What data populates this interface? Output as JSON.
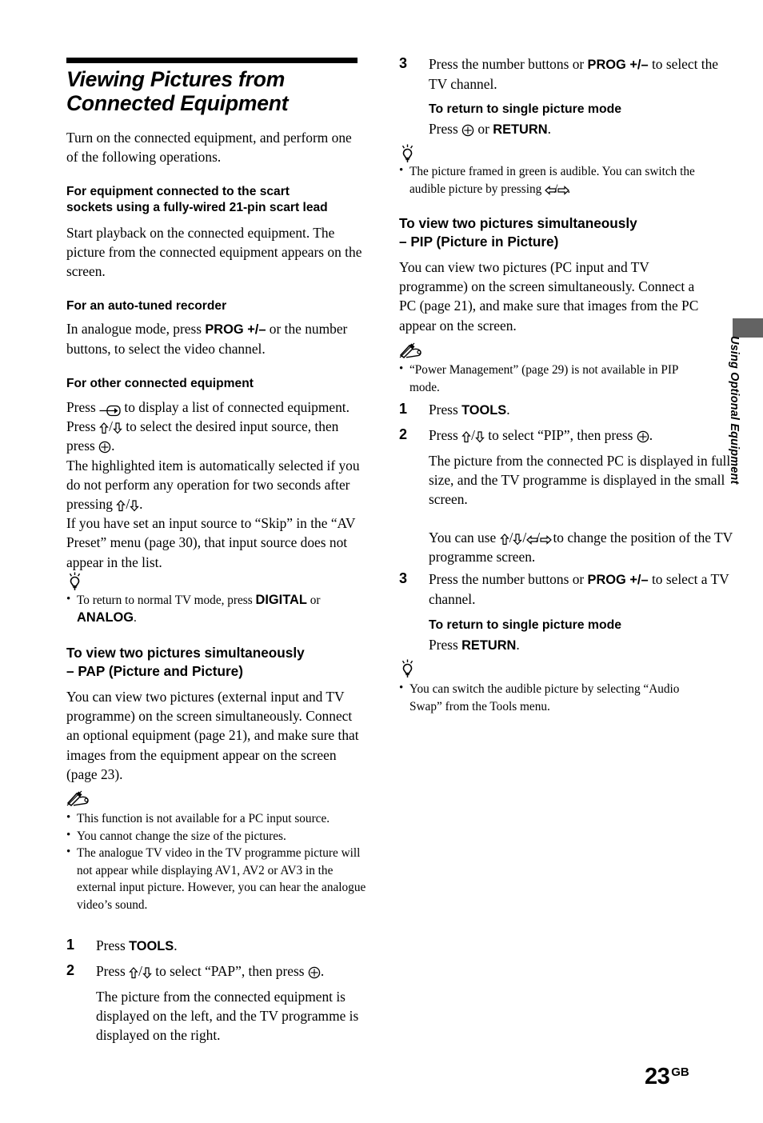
{
  "document": {
    "page_number": "23",
    "page_suffix": "GB",
    "side_tab_label": "Using Optional Equipment"
  },
  "section": {
    "title_line1": "Viewing Pictures from",
    "title_line2": "Connected Equipment",
    "intro": "Turn on the connected equipment, and perform one of the following operations."
  },
  "left_column": {
    "scart": {
      "heading_line1": "For equipment connected to the scart",
      "heading_line2": "sockets using a fully-wired 21-pin scart lead",
      "body": "Start playback on the connected equipment. The picture from the connected equipment appears on the screen."
    },
    "autotuned": {
      "heading": "For an auto-tuned recorder",
      "body_pre": "In analogue mode, press ",
      "body_bold": "PROG +/–",
      "body_post": " or the number buttons, to select the video channel."
    },
    "other_equipment": {
      "heading": "For other connected equipment",
      "p1_a": "Press ",
      "p1_b": " to display a list of connected equipment. Press ",
      "p1_c": " to select the desired input source, then press ",
      "p1_d": ".",
      "p2_a": "The highlighted item is automatically selected if you do not perform any operation for two seconds after pressing ",
      "p2_b": ".",
      "p3": "If you have set an input source to “Skip” in the “AV Preset” menu (page 30), that input source does not appear in the list."
    },
    "tip1": {
      "icon": "tip-bulb-icon",
      "item_a": "To return to normal TV mode, press ",
      "item_bold1": "DIGITAL",
      "item_b": " or ",
      "item_bold2": "ANALOG",
      "item_c": "."
    },
    "pap": {
      "heading_line1": "To view two pictures simultaneously",
      "heading_line2": "– PAP (Picture and Picture)",
      "body": "You can view two pictures (external input and TV programme) on the screen simultaneously. Connect an optional equipment (page 21), and make sure that images from the equipment appear on the screen (page 23).",
      "note_icon": "note-pencil-icon",
      "notes": [
        "This function is not available for a PC input source.",
        "You cannot change the size of the pictures.",
        "The analogue TV video in the TV programme picture will not appear while displaying AV1, AV2 or AV3 in the external input picture. However, you can hear the analogue video’s sound."
      ],
      "step1_num": "1",
      "step1_pre": "Press ",
      "step1_bold": "TOOLS",
      "step1_post": ".",
      "step2_num": "2",
      "step2_a": "Press ",
      "step2_b": " to select “PAP”, then press ",
      "step2_c": ".",
      "step2_body": "The picture from the connected equipment is displayed on the left, and the TV programme is displayed on the right."
    }
  },
  "right_column": {
    "pap_step3": {
      "num": "3",
      "text_pre": "Press the number buttons or ",
      "text_bold": "PROG +/–",
      "text_post": " to select the TV channel.",
      "return_heading": "To return to single picture mode",
      "return_pre": "Press ",
      "return_mid": " or ",
      "return_bold": "RETURN",
      "return_post": "."
    },
    "tip_pap": {
      "icon": "tip-bulb-icon",
      "item_a": "The picture framed in green is audible. You can switch the audible picture by pressing ",
      "item_b": "."
    },
    "pip": {
      "heading_line1": "To view two pictures simultaneously",
      "heading_line2": "– PIP (Picture in Picture)",
      "body": "You can view two pictures (PC input and TV programme) on the screen simultaneously. Connect a PC (page 21), and make sure that images from the PC appear on the screen.",
      "note_icon": "note-pencil-icon",
      "notes": [
        "“Power Management” (page 29) is not available in PIP mode."
      ],
      "step1_num": "1",
      "step1_pre": "Press ",
      "step1_bold": "TOOLS",
      "step1_post": ".",
      "step2_num": "2",
      "step2_a": "Press ",
      "step2_b": " to select “PIP”, then press ",
      "step2_c": ".",
      "step2_body_1": "The picture from the connected PC is displayed in full size, and the TV programme is displayed in the small screen.",
      "step2_body_2a": "You can use ",
      "step2_body_2b": " to change the position of the TV programme screen.",
      "step3_num": "3",
      "step3_pre": "Press the number buttons or ",
      "step3_bold": "PROG +/–",
      "step3_post": " to select a TV channel.",
      "return_heading": "To return to single picture mode",
      "return_pre": "Press ",
      "return_bold": "RETURN",
      "return_post": "."
    },
    "tip_pip": {
      "icon": "tip-bulb-icon",
      "item": "You can switch the audible picture by selecting “Audio Swap” from the Tools menu."
    }
  },
  "icons": {
    "ok_button": "ok-circle-icon",
    "input_select": "input-select-icon",
    "arrow_up": "arrow-up-icon",
    "arrow_down": "arrow-down-icon",
    "arrow_left": "arrow-left-icon",
    "arrow_right": "arrow-right-icon"
  }
}
